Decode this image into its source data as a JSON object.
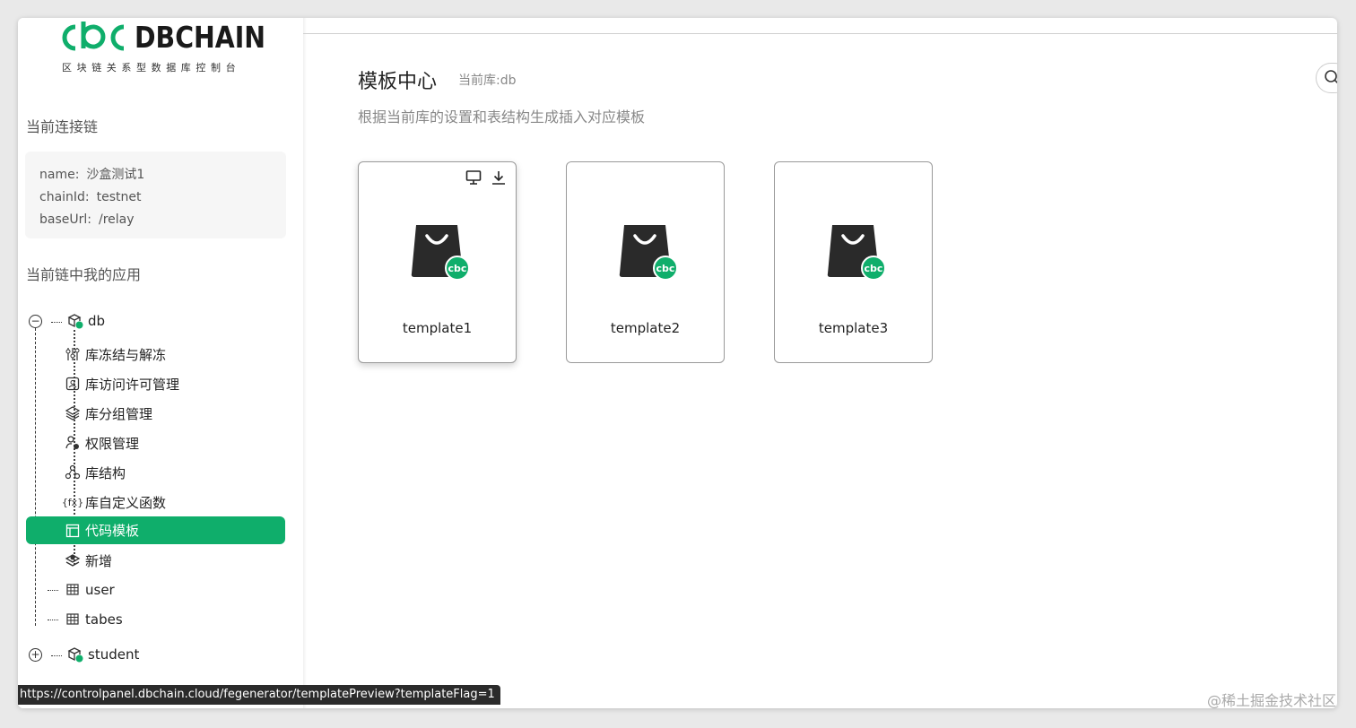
{
  "logo": {
    "text": "DBCHAIN",
    "subtitle": "区块链关系型数据库控制台",
    "brand_color": "#0fae6b"
  },
  "sidebar": {
    "connected_chain_title": "当前连接链",
    "chain": {
      "name_label": "name:",
      "name_value": "沙盒测试1",
      "chainid_label": "chainId:",
      "chainid_value": "testnet",
      "baseurl_label": "baseUrl:",
      "baseurl_value": "/relay"
    },
    "my_apps_title": "当前链中我的应用",
    "tree": {
      "db": {
        "label": "db",
        "toggle": "−",
        "children": [
          {
            "label": "库冻结与解冻",
            "icon": "sliders-icon"
          },
          {
            "label": "库访问许可管理",
            "icon": "id-card-icon"
          },
          {
            "label": "库分组管理",
            "icon": "layers-icon"
          },
          {
            "label": "权限管理",
            "icon": "user-key-icon"
          },
          {
            "label": "库结构",
            "icon": "structure-icon"
          },
          {
            "label": "库自定义函数",
            "icon": "fx-icon"
          },
          {
            "label": "代码模板",
            "icon": "template-icon"
          },
          {
            "label": "新增",
            "icon": "add-layer-icon"
          },
          {
            "label": "user",
            "icon": "table-icon"
          },
          {
            "label": "tabes",
            "icon": "table-icon"
          }
        ]
      },
      "student": {
        "label": "student",
        "toggle": "+"
      }
    }
  },
  "main": {
    "title": "模板中心",
    "current_db": "当前库:db",
    "description": "根据当前库的设置和表结构生成插入对应模板",
    "templates": [
      {
        "name": "template1"
      },
      {
        "name": "template2"
      },
      {
        "name": "template3"
      }
    ]
  },
  "status_url": "https://controlpanel.dbchain.cloud/fegenerator/templatePreview?templateFlag=1",
  "watermark": "@稀土掘金技术社区"
}
